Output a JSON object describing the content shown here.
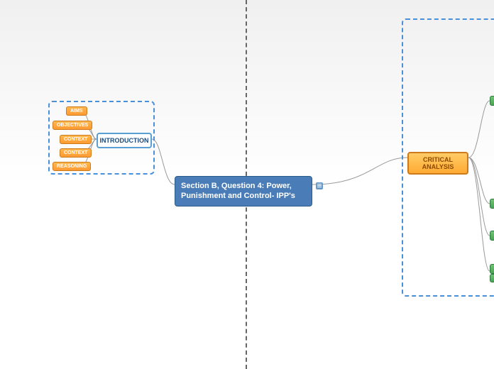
{
  "central": {
    "title": "Section B, Question 4: Power, Punishment and Control- IPP's"
  },
  "left_branch": {
    "label": "INTRODUCTION",
    "children": [
      {
        "label": "AIMS"
      },
      {
        "label": "OBJECTIVES"
      },
      {
        "label": "CONTEXT"
      },
      {
        "label": "CONTEXT"
      },
      {
        "label": "REASONING"
      }
    ]
  },
  "right_branch": {
    "label": "CRITICAL ANALYSIS"
  }
}
